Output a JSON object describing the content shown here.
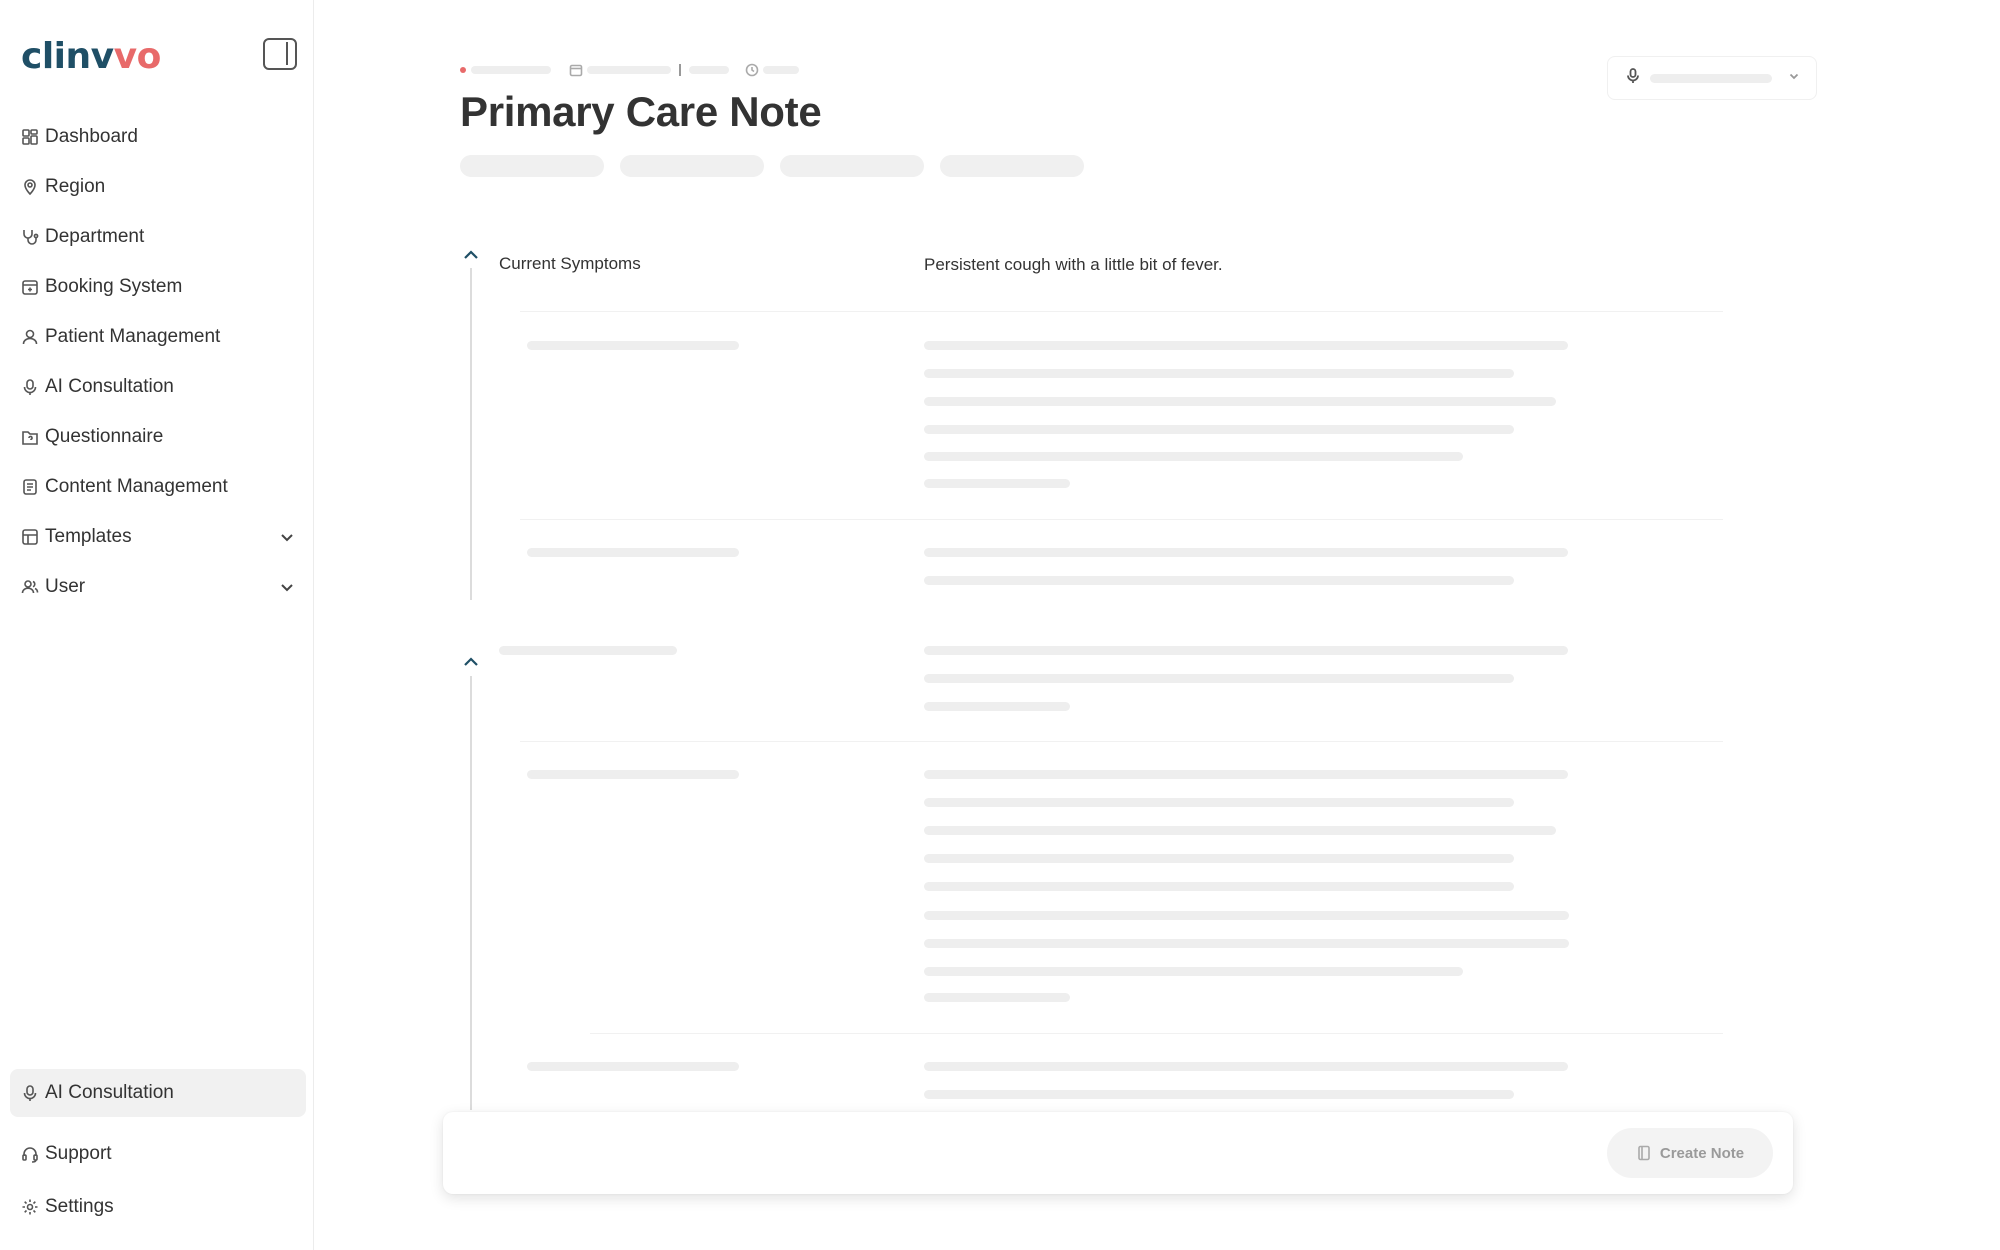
{
  "app": {
    "logo_main": "clinv",
    "logo_accent": "vo"
  },
  "sidebar": {
    "items": [
      {
        "label": "Dashboard",
        "icon": "grid-icon"
      },
      {
        "label": "Region",
        "icon": "map-pin-icon"
      },
      {
        "label": "Department",
        "icon": "stethoscope-icon"
      },
      {
        "label": "Booking System",
        "icon": "calendar-plus-icon"
      },
      {
        "label": "Patient Management",
        "icon": "user-icon"
      },
      {
        "label": "AI Consultation",
        "icon": "mic-icon"
      },
      {
        "label": "Questionnaire",
        "icon": "folder-question-icon"
      },
      {
        "label": "Content Management",
        "icon": "document-icon"
      },
      {
        "label": "Templates",
        "icon": "table-icon",
        "expandable": true
      },
      {
        "label": "User",
        "icon": "users-icon",
        "expandable": true
      }
    ],
    "bottom": [
      {
        "label": "AI Consultation",
        "icon": "mic-icon",
        "active": true
      },
      {
        "label": "Support",
        "icon": "headset-icon"
      },
      {
        "label": "Settings",
        "icon": "gear-icon"
      }
    ]
  },
  "main": {
    "title": "Primary Care Note",
    "sections": [
      {
        "label": "Current Symptoms",
        "value": "Persistent cough with a little bit of fever."
      }
    ],
    "create_note_label": "Create Note"
  },
  "colors": {
    "brand": "#1f4f66",
    "accent": "#e86a6a"
  }
}
